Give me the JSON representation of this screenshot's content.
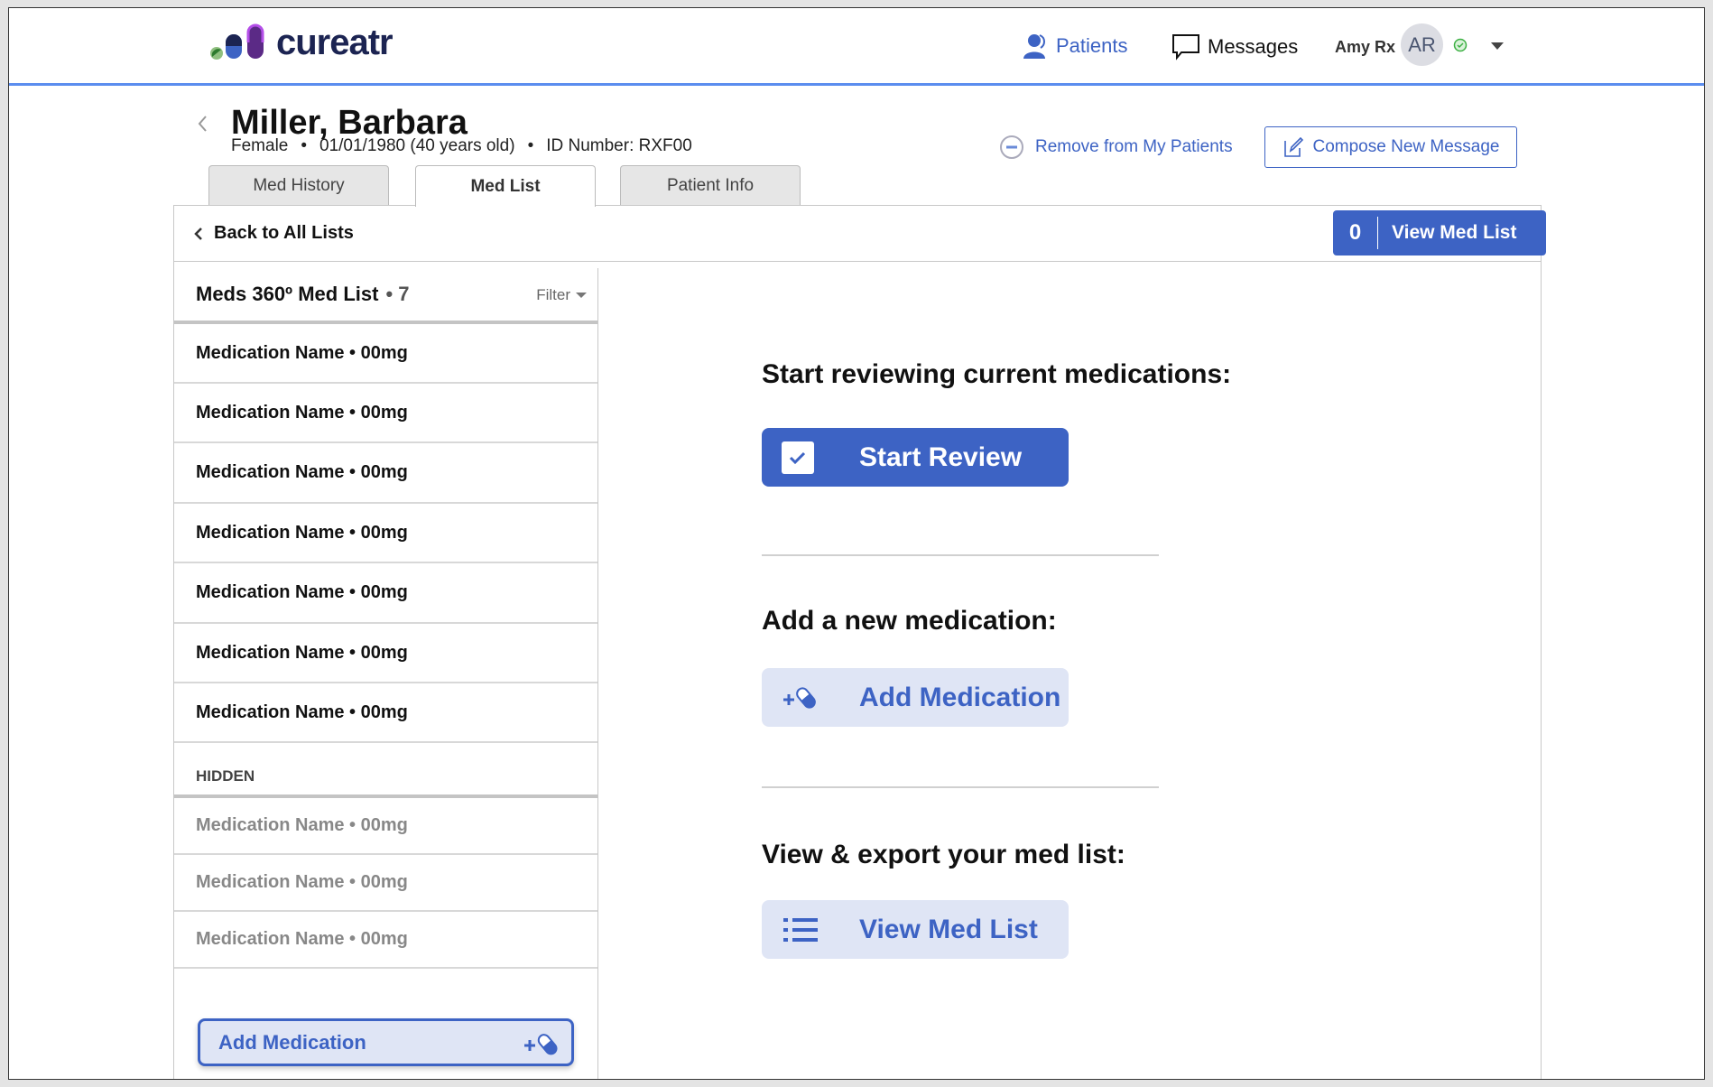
{
  "header": {
    "logo": "cureatr",
    "nav": {
      "patients": "Patients",
      "messages": "Messages"
    },
    "user": {
      "name": "Amy Rx",
      "initials": "AR",
      "status": "online"
    }
  },
  "patient": {
    "name": "Miller, Barbara",
    "sex": "Female",
    "dob": "01/01/1980 (40 years old)",
    "id": "ID Number: RXF00",
    "remove_label": "Remove from My Patients",
    "compose_label": "Compose New Message"
  },
  "tabs": [
    {
      "label": "Med History",
      "active": false
    },
    {
      "label": "Med List",
      "active": true
    },
    {
      "label": "Patient Info",
      "active": false
    }
  ],
  "toolbar": {
    "back_label": "Back to All Lists",
    "count": "0",
    "view_label": "View Med List"
  },
  "list": {
    "title": "Meds 360º Med List",
    "count": "• 7",
    "filter": "Filter",
    "items": [
      "Medication Name • 00mg",
      "Medication Name • 00mg",
      "Medication Name • 00mg",
      "Medication Name • 00mg",
      "Medication Name • 00mg",
      "Medication Name • 00mg",
      "Medication Name • 00mg"
    ],
    "hidden_label": "HIDDEN",
    "hidden_items": [
      "Medication Name • 00mg",
      "Medication Name • 00mg",
      "Medication Name • 00mg"
    ],
    "add_label": "Add Medication"
  },
  "main": {
    "review_heading": "Start reviewing current medications:",
    "review_button": "Start Review",
    "add_heading": "Add a new medication:",
    "add_button": "Add Medication",
    "view_heading": "View & export your med list:",
    "view_button": "View Med List"
  },
  "colors": {
    "primary": "#3d63c4",
    "light": "#dfe5f5",
    "header_line": "#5b8def",
    "status": "#3cb043"
  }
}
